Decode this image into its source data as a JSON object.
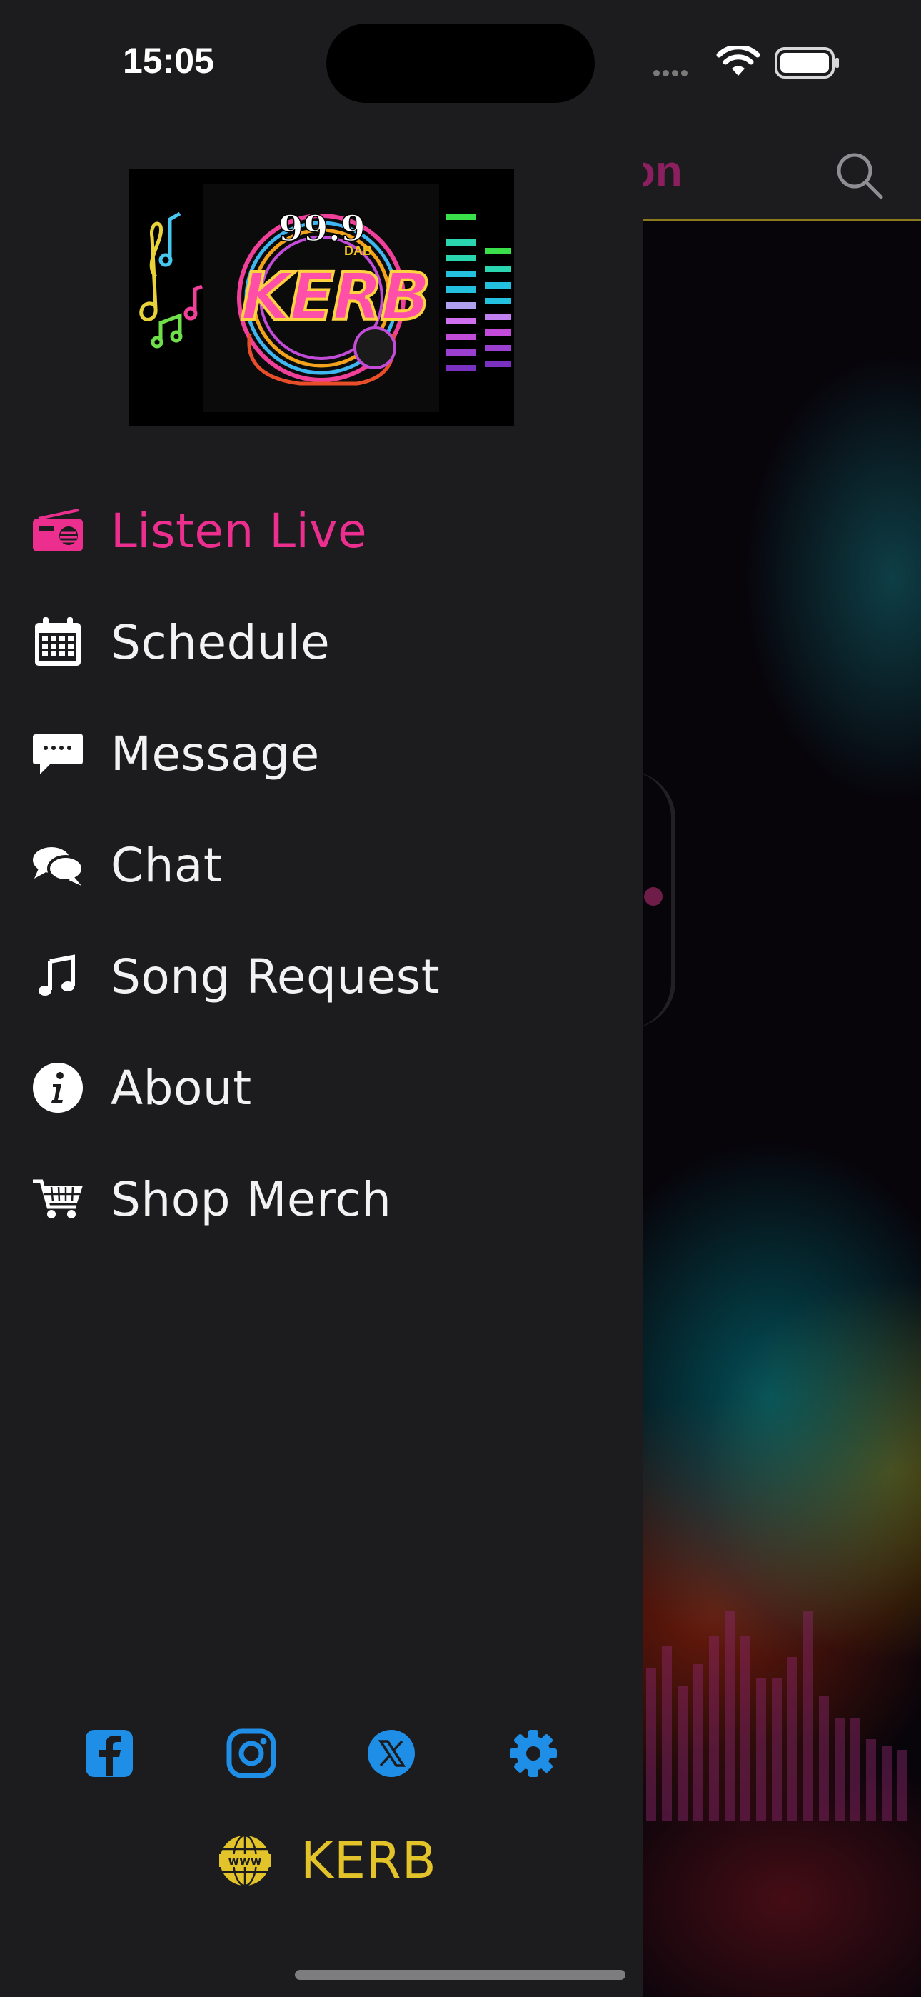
{
  "status_bar": {
    "time": "15:05"
  },
  "background": {
    "title_fragment": "on",
    "title_color": "#8c1f5f"
  },
  "drawer": {
    "logo": {
      "frequency": "99.9",
      "band": "DAB",
      "name": "KERB"
    },
    "menu": [
      {
        "label": "Listen Live",
        "icon": "radio-icon",
        "active": true
      },
      {
        "label": "Schedule",
        "icon": "calendar-icon",
        "active": false
      },
      {
        "label": "Message",
        "icon": "message-bubble-icon",
        "active": false
      },
      {
        "label": "Chat",
        "icon": "chat-bubbles-icon",
        "active": false
      },
      {
        "label": "Song Request",
        "icon": "music-note-icon",
        "active": false
      },
      {
        "label": "About",
        "icon": "info-icon",
        "active": false
      },
      {
        "label": "Shop Merch",
        "icon": "cart-icon",
        "active": false
      }
    ],
    "socials": [
      "facebook-icon",
      "instagram-icon",
      "x-icon",
      "settings-gear-icon"
    ],
    "footer": {
      "label": "KERB",
      "icon": "www-globe-icon"
    }
  },
  "colors": {
    "drawer_bg": "#1c1c1e",
    "active": "#ec2f8f",
    "menu_text": "#f2f2f2",
    "social_blue": "#1f8ee6",
    "footer_gold": "#e3c32a"
  }
}
